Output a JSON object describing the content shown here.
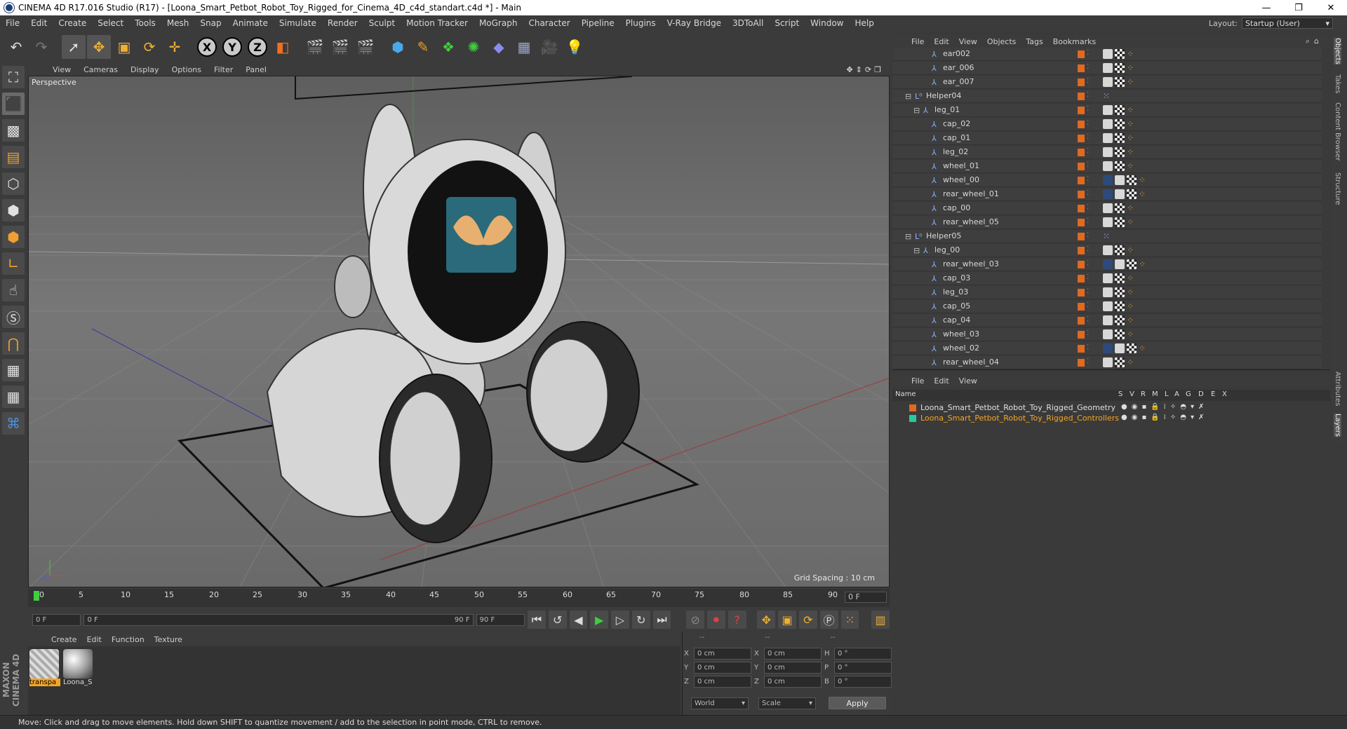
{
  "window": {
    "title": "CINEMA 4D R17.016 Studio (R17) - [Loona_Smart_Petbot_Robot_Toy_Rigged_for_Cinema_4D_c4d_standart.c4d *] - Main",
    "minimize": "—",
    "restore": "❐",
    "close": "✕"
  },
  "menubar": {
    "items": [
      "File",
      "Edit",
      "Create",
      "Select",
      "Tools",
      "Mesh",
      "Snap",
      "Animate",
      "Simulate",
      "Render",
      "Sculpt",
      "Motion Tracker",
      "MoGraph",
      "Character",
      "Pipeline",
      "Plugins",
      "V-Ray Bridge",
      "3DToAll",
      "Script",
      "Window",
      "Help"
    ],
    "layout_label": "Layout:",
    "layout_value": "Startup (User)"
  },
  "toolbar": {
    "x_label": "X",
    "y_label": "Y",
    "z_label": "Z"
  },
  "viewport": {
    "menu": [
      "View",
      "Cameras",
      "Display",
      "Options",
      "Filter",
      "Panel"
    ],
    "label": "Perspective",
    "grid_spacing": "Grid Spacing : 10 cm"
  },
  "timeline": {
    "ticks": [
      "0",
      "5",
      "10",
      "15",
      "20",
      "25",
      "30",
      "35",
      "40",
      "45",
      "50",
      "55",
      "60",
      "65",
      "70",
      "75",
      "80",
      "85",
      "90"
    ],
    "current_frame": "0 F",
    "start_field": "0 F",
    "range_start": "0 F",
    "range_end": "90 F",
    "end_field": "90 F"
  },
  "materials": {
    "menu": [
      "Create",
      "Edit",
      "Function",
      "Texture"
    ],
    "items": [
      {
        "name": "transpa",
        "selected": true
      },
      {
        "name": "Loona_S",
        "selected": false
      }
    ]
  },
  "coordinates": {
    "header": [
      "--",
      "--",
      "--"
    ],
    "rows": [
      {
        "a": "X",
        "av": "0 cm",
        "b": "X",
        "bv": "0 cm",
        "c": "H",
        "cv": "0 °"
      },
      {
        "a": "Y",
        "av": "0 cm",
        "b": "Y",
        "bv": "0 cm",
        "c": "P",
        "cv": "0 °"
      },
      {
        "a": "Z",
        "av": "0 cm",
        "b": "Z",
        "bv": "0 cm",
        "c": "B",
        "cv": "0 °"
      }
    ],
    "world": "World",
    "scale": "Scale",
    "apply": "Apply"
  },
  "status": "Move: Click and drag to move elements. Hold down SHIFT to quantize movement / add to the selection in point mode, CTRL to remove.",
  "objects": {
    "menu": [
      "File",
      "Edit",
      "View",
      "Objects",
      "Tags",
      "Bookmarks"
    ],
    "rows": [
      {
        "name": "ear002",
        "indent": 3,
        "type": "bone",
        "tags": 3
      },
      {
        "name": "ear_006",
        "indent": 3,
        "type": "bone",
        "tags": 3
      },
      {
        "name": "ear_007",
        "indent": 3,
        "type": "bone",
        "tags": 3
      },
      {
        "name": "Helper04",
        "indent": 1,
        "type": "null",
        "tags": 0
      },
      {
        "name": "leg_01",
        "indent": 2,
        "type": "bone",
        "tags": 3
      },
      {
        "name": "cap_02",
        "indent": 3,
        "type": "bone",
        "tags": 3
      },
      {
        "name": "cap_01",
        "indent": 3,
        "type": "bone",
        "tags": 3
      },
      {
        "name": "leg_02",
        "indent": 3,
        "type": "bone",
        "tags": 3
      },
      {
        "name": "wheel_01",
        "indent": 3,
        "type": "bone",
        "tags": 3
      },
      {
        "name": "wheel_00",
        "indent": 3,
        "type": "bone",
        "tags": 4
      },
      {
        "name": "rear_wheel_01",
        "indent": 3,
        "type": "bone",
        "tags": 4
      },
      {
        "name": "cap_00",
        "indent": 3,
        "type": "bone",
        "tags": 3
      },
      {
        "name": "rear_wheel_05",
        "indent": 3,
        "type": "bone",
        "tags": 3
      },
      {
        "name": "Helper05",
        "indent": 1,
        "type": "null",
        "tags": 0
      },
      {
        "name": "leg_00",
        "indent": 2,
        "type": "bone",
        "tags": 3
      },
      {
        "name": "rear_wheel_03",
        "indent": 3,
        "type": "bone",
        "tags": 4
      },
      {
        "name": "cap_03",
        "indent": 3,
        "type": "bone",
        "tags": 3
      },
      {
        "name": "leg_03",
        "indent": 3,
        "type": "bone",
        "tags": 3
      },
      {
        "name": "cap_05",
        "indent": 3,
        "type": "bone",
        "tags": 3
      },
      {
        "name": "cap_04",
        "indent": 3,
        "type": "bone",
        "tags": 3
      },
      {
        "name": "wheel_03",
        "indent": 3,
        "type": "bone",
        "tags": 3
      },
      {
        "name": "wheel_02",
        "indent": 3,
        "type": "bone",
        "tags": 4
      },
      {
        "name": "rear_wheel_04",
        "indent": 3,
        "type": "bone",
        "tags": 3
      }
    ]
  },
  "sidetabs": [
    "Objects",
    "Takes",
    "Content Browser",
    "Structure",
    "Attributes",
    "Layers"
  ],
  "layers": {
    "menu": [
      "File",
      "Edit",
      "View"
    ],
    "columns": [
      "Name",
      "S",
      "V",
      "R",
      "M",
      "L",
      "A",
      "G",
      "D",
      "E",
      "X"
    ],
    "rows": [
      {
        "name": "Loona_Smart_Petbot_Robot_Toy_Rigged_Geometry",
        "color": "#e06a20",
        "selected": false
      },
      {
        "name": "Loona_Smart_Petbot_Robot_Toy_Rigged_Controllers",
        "color": "#28c8a0",
        "selected": true
      }
    ]
  }
}
